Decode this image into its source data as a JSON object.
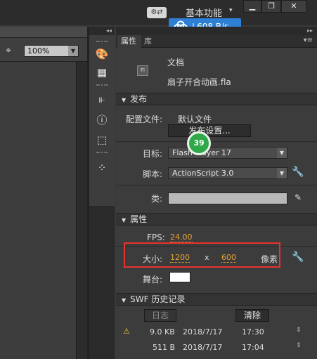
{
  "topbar": {
    "workspace": "基本功能",
    "workspace_caret": "▾",
    "min": "▁",
    "max": "❐",
    "close": "✕",
    "speed": "608 B/s",
    "sync_icon": "sync-settings-icon"
  },
  "stage": {
    "zoom": "100%"
  },
  "panel": {
    "tabs": [
      "属性",
      "库"
    ],
    "document": {
      "icon_label": "Fl",
      "type": "文档",
      "name": "扇子开合动画.fla"
    },
    "publish": {
      "title": "发布",
      "profile_label": "配置文件:",
      "profile_value": "默认文件",
      "settings_button": "发布设置...",
      "target_label": "目标:",
      "target_value": "Flash Player 17",
      "script_label": "脚本:",
      "script_value": "ActionScript 3.0",
      "class_label": "类:"
    },
    "properties": {
      "title": "属性",
      "fps_label": "FPS:",
      "fps_value": "24.00",
      "size_label": "大小:",
      "width": "1200",
      "x": "x",
      "height": "600",
      "unit": "像素",
      "stage_label": "舞台:",
      "stage_color": "#ffffff"
    },
    "swf_history": {
      "title": "SWF 历史记录",
      "log_button": "日志",
      "clear_button": "清除",
      "rows": [
        {
          "size": "9.0 KB",
          "date": "2018/7/17",
          "time": "17:30",
          "warning": true
        },
        {
          "size": "511 B",
          "date": "2018/7/17",
          "time": "17:04",
          "warning": false
        }
      ]
    },
    "badge": "39"
  },
  "colors": {
    "accent_blue": "#2e7fd6",
    "highlight_red": "#e8322d",
    "value_orange": "#e8a533",
    "badge_green": "#2fa84a"
  }
}
